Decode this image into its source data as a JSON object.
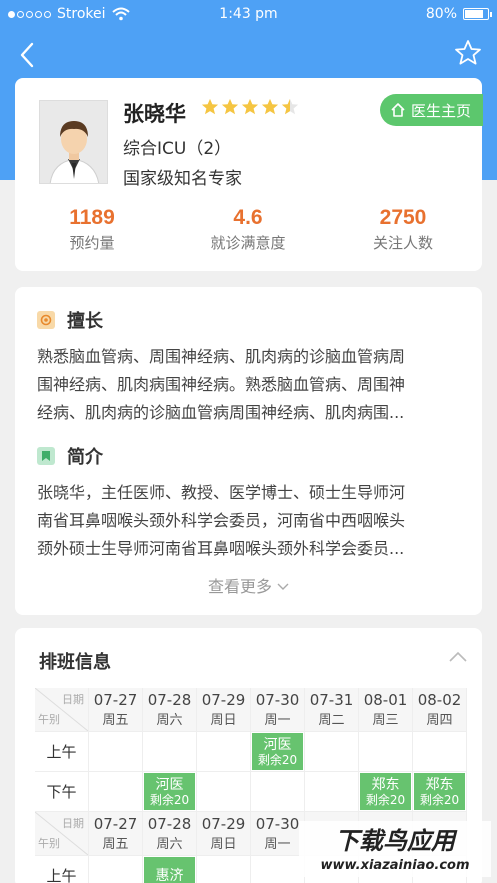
{
  "status_bar": {
    "carrier": "Strokei",
    "time": "1:43 pm",
    "battery": "80%"
  },
  "doctor": {
    "name": "张晓华",
    "rating_stars": 4.5,
    "department": "综合ICU（2）",
    "title": "国家级知名专家",
    "home_button": "医生主页"
  },
  "stats": [
    {
      "value": "1189",
      "label": "预约量"
    },
    {
      "value": "4.6",
      "label": "就诊满意度"
    },
    {
      "value": "2750",
      "label": "关注人数"
    }
  ],
  "specialty": {
    "heading": "擅长",
    "lines": [
      "熟悉脑血管病、周围神经病、肌肉病的诊脑血管病周",
      "围神经病、肌肉病围神经病。熟悉脑血管病、周围神",
      "经病、肌肉病的诊脑血管病周围神经病、肌肉病围..."
    ]
  },
  "intro": {
    "heading": "简介",
    "lines": [
      "张晓华，主任医师、教授、医学博士、硕士生导师河",
      "南省耳鼻咽喉头颈外科学会委员，河南省中西咽喉头",
      "颈外硕士生导师河南省耳鼻咽喉头颈外科学会委员..."
    ]
  },
  "more_label": "查看更多",
  "schedule": {
    "title": "排班信息",
    "corner_top": "日期",
    "corner_bottom": "午别",
    "days": [
      {
        "date": "07-27",
        "weekday": "周五"
      },
      {
        "date": "07-28",
        "weekday": "周六"
      },
      {
        "date": "07-29",
        "weekday": "周日"
      },
      {
        "date": "07-30",
        "weekday": "周一"
      },
      {
        "date": "07-31",
        "weekday": "周二"
      },
      {
        "date": "08-01",
        "weekday": "周三"
      },
      {
        "date": "08-02",
        "weekday": "周四"
      }
    ],
    "morning_label": "上午",
    "afternoon_label": "下午",
    "morning_slots": [
      null,
      null,
      null,
      {
        "hospital": "河医",
        "remain": "剩余20"
      },
      null,
      null,
      null
    ],
    "afternoon_slots": [
      null,
      {
        "hospital": "河医",
        "remain": "剩余20"
      },
      null,
      null,
      null,
      {
        "hospital": "郑东",
        "remain": "剩余20"
      },
      {
        "hospital": "郑东",
        "remain": "剩余20"
      }
    ],
    "week2_days": [
      {
        "date": "07-27",
        "weekday": "周五"
      },
      {
        "date": "07-28",
        "weekday": "周六"
      },
      {
        "date": "07-29",
        "weekday": "周日"
      },
      {
        "date": "07-30",
        "weekday": "周一"
      }
    ],
    "week2_morning_slots": [
      null,
      {
        "hospital": "惠济",
        "remain": ""
      }
    ]
  },
  "watermark": {
    "line1": "下载鸟应用",
    "line2": "www.xiazainiao.com"
  },
  "colors": {
    "header": "#4ea1f5",
    "accent": "#e8712f",
    "green": "#67c36f",
    "star": "#f5c542"
  }
}
